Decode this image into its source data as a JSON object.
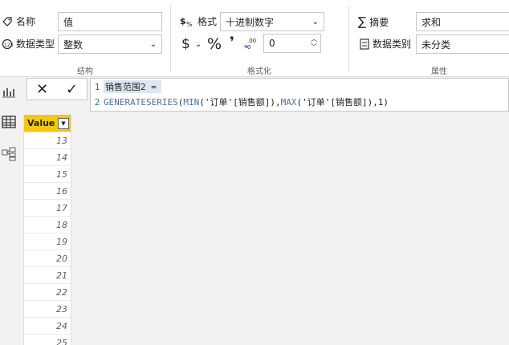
{
  "structure_group": {
    "name_label": "名称",
    "name_value": "值",
    "datatype_label": "数据类型",
    "datatype_value": "整数",
    "group_label": "结构"
  },
  "format_group": {
    "format_label": "格式",
    "format_value": "十进制数字",
    "currency_symbol": "$",
    "percent_symbol": "%",
    "comma_symbol": "❜",
    "decimals_value": "0",
    "group_label": "格式化"
  },
  "properties_group": {
    "summary_label": "摘要",
    "summary_value": "求和",
    "category_label": "数据类别",
    "category_value": "未分类",
    "group_label": "属性"
  },
  "formula_bar": {
    "cancel": "✕",
    "commit": "✓",
    "line1_num": "1",
    "line1_text": "销售范围2 =",
    "line2_num": "2",
    "line2_fn1": "GENERATESERIES",
    "line2_p1": "(",
    "line2_fn2": "MIN",
    "line2_p2": "('订单'[销售额]),",
    "line2_fn3": "MAX",
    "line2_p3": "('订单'[销售额]),1)"
  },
  "table": {
    "column_header": "Value",
    "rows": [
      "13",
      "14",
      "15",
      "16",
      "17",
      "18",
      "19",
      "20",
      "21",
      "22",
      "23",
      "24",
      "25"
    ]
  },
  "colors": {
    "header_yellow": "#f2c811",
    "dax_function_blue": "#4a6fa5"
  }
}
